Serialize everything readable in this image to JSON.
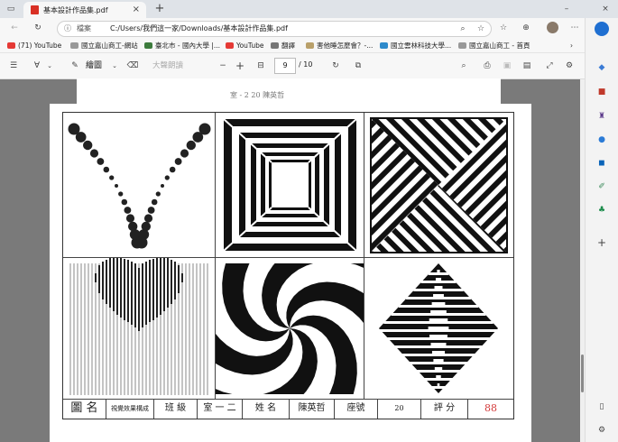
{
  "browser": {
    "tab_title": "基本設計作品集.pdf",
    "address_label": "檔案",
    "url": "C:/Users/我們這一家/Downloads/基本設計作品集.pdf"
  },
  "bookmarks": [
    {
      "label": "(71) YouTube",
      "color": "#e53935"
    },
    {
      "label": "國立嘉山商工-網站",
      "color": "#999999"
    },
    {
      "label": "臺北市 - 國內大學 |...",
      "color": "#3c7b3c"
    },
    {
      "label": "YouTube",
      "color": "#e53935"
    },
    {
      "label": "翻譯",
      "color": "#777777"
    },
    {
      "label": "害他睡怎麼會？-...",
      "color": "#b9a06a"
    },
    {
      "label": "國立雲林科技大學...",
      "color": "#2d8acb"
    },
    {
      "label": "國立嘉山商工 - 首頁",
      "color": "#999999"
    }
  ],
  "pdf_toolbar": {
    "draw_label": "繪圖",
    "read_aloud_label": "大聲朗讀",
    "page_current": "9",
    "page_total": "/ 10"
  },
  "page_top_caption": "室 - 2   20  陳英哲",
  "artwork": {
    "label_name_title": "圖 名",
    "label_name_value": "視覺效果構成",
    "label_class_title": "班 級",
    "label_class_value": "室 一 二",
    "label_person_title": "姓 名",
    "label_person_value": "陳英哲",
    "label_seat_title": "座號",
    "label_seat_value": "20",
    "label_score_title": "評 分",
    "label_score_value": "88",
    "score_color": "#d33a3a"
  }
}
